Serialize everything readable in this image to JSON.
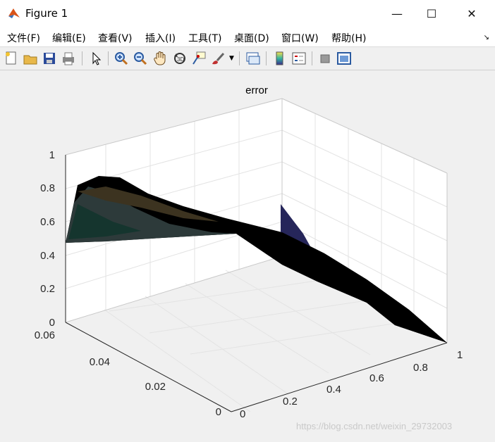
{
  "window": {
    "title": "Figure 1",
    "minimize": "—",
    "maximize": "☐",
    "close": "✕"
  },
  "menu": [
    "文件(F)",
    "编辑(E)",
    "查看(V)",
    "插入(I)",
    "工具(T)",
    "桌面(D)",
    "窗口(W)",
    "帮助(H)"
  ],
  "toolbar": {
    "icons": [
      "new-figure-icon",
      "open-file-icon",
      "save-icon",
      "print-icon",
      "select-arrow-icon",
      "zoom-in-icon",
      "zoom-out-icon",
      "pan-hand-icon",
      "rotate-3d-icon",
      "data-cursor-icon",
      "brush-icon",
      "brush-dropdown-icon",
      "link-plot-icon",
      "colorbar-icon",
      "legend-icon",
      "hide-plot-tools-icon",
      "show-plot-tools-icon"
    ]
  },
  "plot": {
    "title": "error",
    "z_ticks": [
      "0",
      "0.2",
      "0.4",
      "0.6",
      "0.8",
      "1"
    ],
    "y_ticks": [
      "0",
      "0.02",
      "0.04",
      "0.06"
    ],
    "x_ticks": [
      "0",
      "0.2",
      "0.4",
      "0.6",
      "0.8",
      "1"
    ]
  },
  "watermark": "https://blog.csdn.net/weixin_29732003",
  "colors": {
    "surface": "#000000",
    "surface_tint": "#2a2a55",
    "accent": "#3a2a1a",
    "grid": "#dedede",
    "axis": "#262626"
  }
}
